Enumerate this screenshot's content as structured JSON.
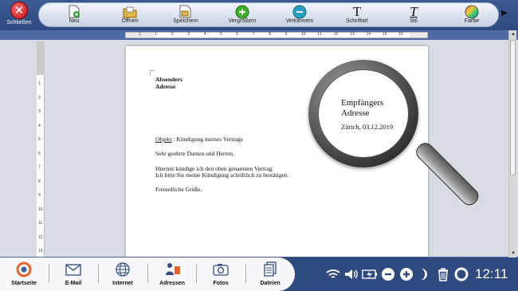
{
  "toolbar": {
    "close": "Schließen",
    "buttons": [
      "Neu",
      "Öffnen",
      "Speichern",
      "Vergrößern",
      "Verkleinern",
      "Schriftart",
      "Stil",
      "Farbe"
    ]
  },
  "ruler": {
    "labels": [
      "1",
      "1",
      "2",
      "3",
      "4",
      "5",
      "6",
      "7",
      "8",
      "9",
      "10",
      "11",
      "12",
      "13",
      "14",
      "15",
      "16"
    ],
    "vertical_labels": [
      "1",
      "2",
      "3",
      "4",
      "5",
      "6",
      "7",
      "8",
      "9",
      "10",
      "11",
      "12",
      "13"
    ]
  },
  "document": {
    "sender": [
      "Absenders",
      "Adresse"
    ],
    "subject_label": "Objekt",
    "subject": ": Kündigung meines Vertrags",
    "salutation": "Sehr geehrte Damen und Herren,",
    "body": [
      "Hiermit kündige ich den oben genannten Vertrag.",
      "Ich bitte Sie meine Kündigung schriftlich zu bestätigen."
    ],
    "closing": "Freundliche Grüße,",
    "recipient": [
      "Empfängers",
      "Adresse"
    ],
    "date_line": "Zürich, 03.12.2019"
  },
  "taskbar": {
    "apps": [
      "Startseite",
      "E-Mail",
      "Internet",
      "Adressen",
      "Fotos",
      "Dateien"
    ],
    "clock": "12:11"
  }
}
